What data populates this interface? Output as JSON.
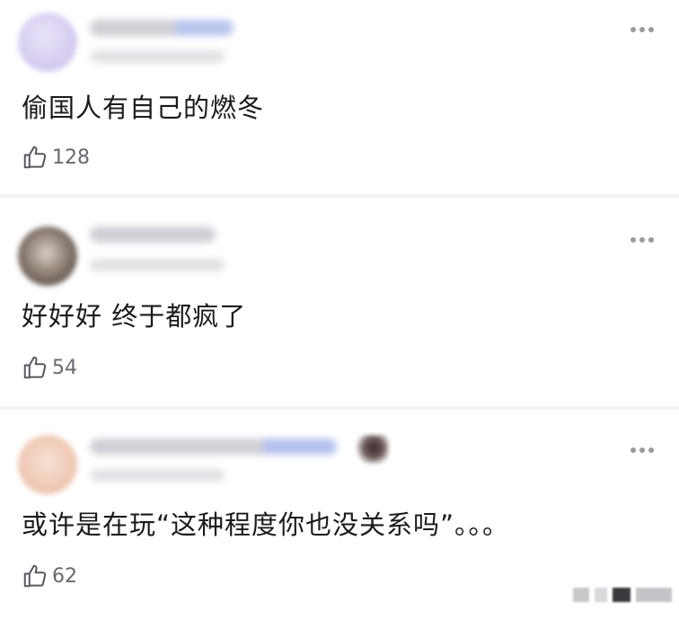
{
  "comments": [
    {
      "text": "偷国人有自己的燃冬",
      "likes": "128"
    },
    {
      "text": "好好好 终于都疯了",
      "likes": "54"
    },
    {
      "text": "或许是在玩“这种程度你也没关系吗”。。。",
      "likes": "62"
    }
  ],
  "icons": {
    "like": "thumbs-up-icon",
    "more": "more-dots-icon"
  },
  "colors": {
    "text": "#1a1a1a",
    "like_count": "#666a70",
    "dots": "#9a9aa0",
    "separator": "#f2f2f4"
  }
}
